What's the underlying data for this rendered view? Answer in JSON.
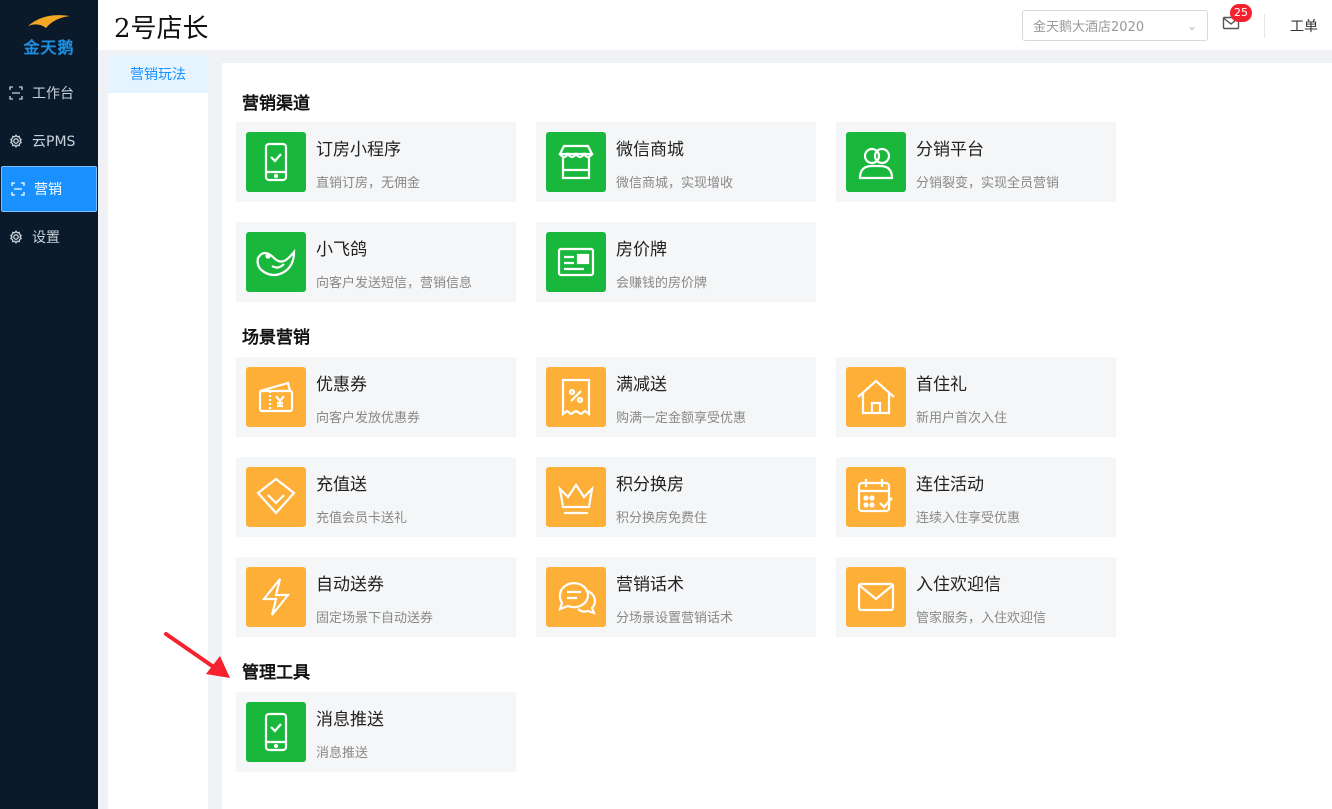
{
  "sidebar": {
    "logo_text": "金天鹅",
    "items": [
      {
        "label": "工作台",
        "icon": "scan-icon",
        "active": false
      },
      {
        "label": "云PMS",
        "icon": "gear-icon",
        "active": false
      },
      {
        "label": "营销",
        "icon": "scan-icon",
        "active": true
      },
      {
        "label": "设置",
        "icon": "gear-icon",
        "active": false
      }
    ]
  },
  "header": {
    "brand": "2号店长",
    "hotel_select": "金天鹅大酒店2020",
    "mail_badge": "25",
    "ticket_label": "工单"
  },
  "subnav": {
    "items": [
      {
        "label": "营销玩法"
      }
    ]
  },
  "sections": [
    {
      "title": "营销渠道",
      "cards": [
        {
          "title": "订房小程序",
          "desc": "直销订房，无佣金",
          "icon": "phone-check-icon",
          "color": "#19b83c"
        },
        {
          "title": "微信商城",
          "desc": "微信商城，实现增收",
          "icon": "store-icon",
          "color": "#19b83c"
        },
        {
          "title": "分销平台",
          "desc": "分销裂变，实现全员营销",
          "icon": "users-icon",
          "color": "#19b83c"
        },
        {
          "title": "小飞鸽",
          "desc": "向客户发送短信，营销信息",
          "icon": "bird-icon",
          "color": "#19b83c"
        },
        {
          "title": "房价牌",
          "desc": "会赚钱的房价牌",
          "icon": "price-board-icon",
          "color": "#19b83c"
        }
      ]
    },
    {
      "title": "场景营销",
      "cards": [
        {
          "title": "优惠券",
          "desc": "向客户发放优惠券",
          "icon": "coupon-icon",
          "color": "#fdaf38"
        },
        {
          "title": "满减送",
          "desc": "购满一定金额享受优惠",
          "icon": "percent-icon",
          "color": "#fdaf38"
        },
        {
          "title": "首住礼",
          "desc": "新用户首次入住",
          "icon": "house-icon",
          "color": "#fdaf38"
        },
        {
          "title": "充值送",
          "desc": "充值会员卡送礼",
          "icon": "diamond-icon",
          "color": "#fdaf38"
        },
        {
          "title": "积分换房",
          "desc": "积分换房免费住",
          "icon": "crown-icon",
          "color": "#fdaf38"
        },
        {
          "title": "连住活动",
          "desc": "连续入住享受优惠",
          "icon": "calendar-check-icon",
          "color": "#fdaf38"
        },
        {
          "title": "自动送券",
          "desc": "固定场景下自动送券",
          "icon": "lightning-icon",
          "color": "#fdaf38"
        },
        {
          "title": "营销话术",
          "desc": "分场景设置营销话术",
          "icon": "chat-icon",
          "color": "#fdaf38"
        },
        {
          "title": "入住欢迎信",
          "desc": "管家服务，入住欢迎信",
          "icon": "envelope-icon",
          "color": "#fdaf38"
        }
      ]
    },
    {
      "title": "管理工具",
      "cards": [
        {
          "title": "消息推送",
          "desc": "消息推送",
          "icon": "phone-check-icon",
          "color": "#19b83c"
        }
      ]
    }
  ]
}
